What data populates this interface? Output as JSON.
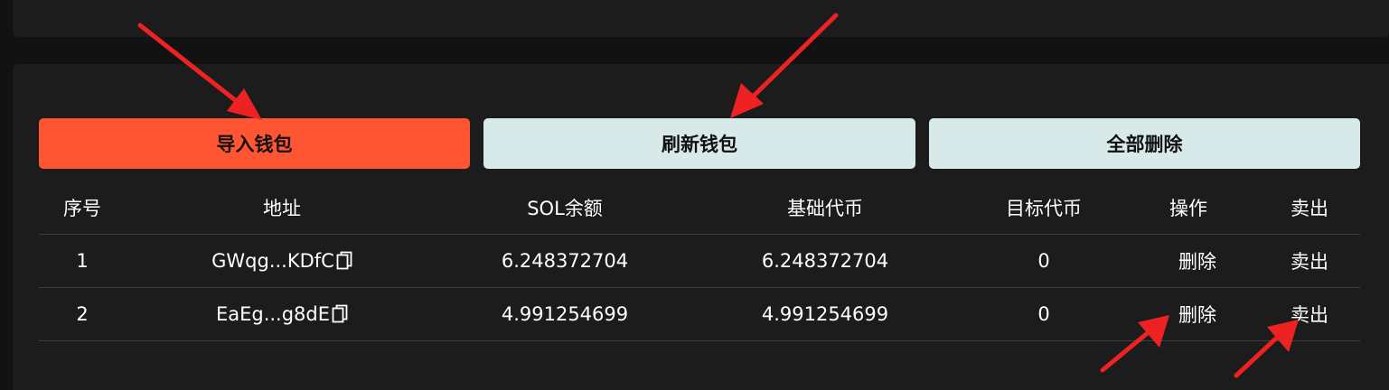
{
  "toolbar": {
    "import_label": "导入钱包",
    "refresh_label": "刷新钱包",
    "delete_all_label": "全部删除"
  },
  "colors": {
    "import_button": "#ff5532",
    "secondary_button": "#d8e9e9",
    "panel": "#1c1c1c",
    "background": "#121212",
    "annotation_arrow": "#ee2222"
  },
  "table": {
    "headers": {
      "index": "序号",
      "address": "地址",
      "sol_balance": "SOL余额",
      "base_token": "基础代币",
      "target_token": "目标代币",
      "action": "操作",
      "sell": "卖出"
    },
    "rows": [
      {
        "index": "1",
        "address": "GWqg...KDfC",
        "sol_balance": "6.248372704",
        "base_token": "6.248372704",
        "target_token": "0",
        "delete_label": "删除",
        "sell_label": "卖出"
      },
      {
        "index": "2",
        "address": "EaEg...g8dE",
        "sol_balance": "4.991254699",
        "base_token": "4.991254699",
        "target_token": "0",
        "delete_label": "删除",
        "sell_label": "卖出"
      }
    ]
  },
  "icons": {
    "copy": "copy-icon",
    "annotation": "red-arrow-icon"
  }
}
